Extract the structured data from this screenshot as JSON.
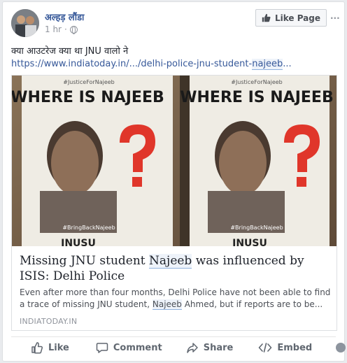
{
  "post": {
    "page_name": "अल्हड़ लौंडा",
    "time": "1 hr",
    "separator": "·",
    "text": "क्या आउटरेज क्या था JNU वालो ने",
    "link_prefix": "https://www.indiatoday.in/.../delhi-police-jnu-student-",
    "link_highlight": "najeeb",
    "link_suffix": "..."
  },
  "header": {
    "like_page_label": "Like Page",
    "menu_label": "···"
  },
  "preview": {
    "poster_left": {
      "top_tag": "#JusticeForNajeeb",
      "title": "WHERE IS NAJEEB",
      "bottom_tag": "#BringBackNajeeb",
      "strip_text": "INUSU"
    },
    "poster_right": {
      "top_tag": "#JusticeForNajeeb",
      "title": "WHERE IS NAJEEB",
      "bottom_tag": "#BringBackNajeeb",
      "strip_text": "INUSU"
    },
    "headline_1": "Missing JNU student ",
    "headline_hl": "Najeeb",
    "headline_2": " was influenced by ISIS: Delhi Police",
    "desc_1": "Even after more than four months, Delhi Police have not been able to find a trace of missing JNU student, ",
    "desc_hl": "Najeeb",
    "desc_2": " Ahmed, but if reports are to be...",
    "source": "INDIATODAY.IN"
  },
  "actions": {
    "like": "Like",
    "comment": "Comment",
    "share": "Share",
    "embed": "Embed"
  },
  "colors": {
    "link": "#365899",
    "accent_question": "#e0362a"
  },
  "icons": [
    "thumbs-up-icon",
    "globe-icon",
    "like-icon",
    "comment-icon",
    "share-icon",
    "embed-icon",
    "reaction-face-icon"
  ]
}
